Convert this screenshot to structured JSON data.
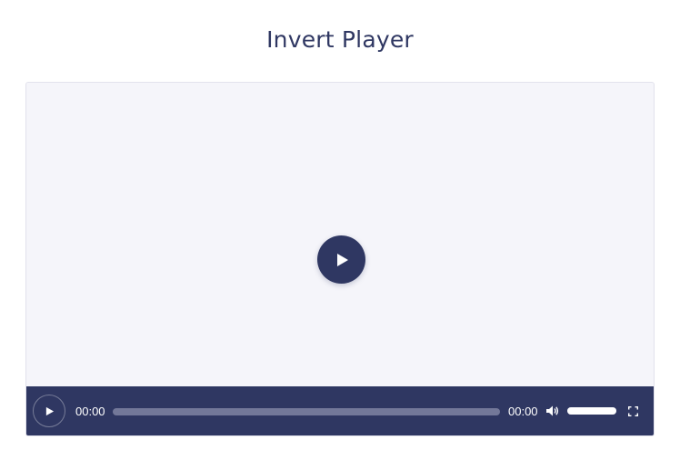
{
  "page": {
    "title": "Invert Player"
  },
  "player": {
    "big_play_icon": "play-icon",
    "controls": {
      "play_icon": "play-icon",
      "current_time": "00:00",
      "duration": "00:00",
      "progress": 0,
      "volume_icon": "volume-icon",
      "volume_level": 1.0,
      "fullscreen_icon": "fullscreen-icon"
    }
  },
  "colors": {
    "accent": "#2f3762",
    "stage_background": "#f5f5fa",
    "track": "#737899",
    "foreground": "#ffffff"
  }
}
